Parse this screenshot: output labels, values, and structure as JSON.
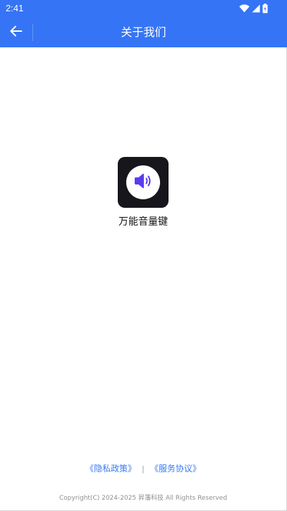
{
  "status_bar": {
    "time": "2:41",
    "icons": [
      "wifi-icon",
      "cell-signal-icon",
      "battery-icon"
    ],
    "background": "#3574f5"
  },
  "app_bar": {
    "title": "关于我们",
    "back_icon": "back-arrow-icon",
    "background": "#3574f5"
  },
  "app_info": {
    "icon": "speaker-volume-icon",
    "name": "万能音量键",
    "icon_colors": {
      "tile": "#16161c",
      "glyph": "#5a3cf0"
    }
  },
  "footer": {
    "privacy_link": "《隐私政策》",
    "separator": "|",
    "terms_link": "《服务协议》",
    "copyright": "Copyright(C) 2024-2025 昇藩科技 All Rights Reserved",
    "link_color": "#3a7cf0"
  }
}
